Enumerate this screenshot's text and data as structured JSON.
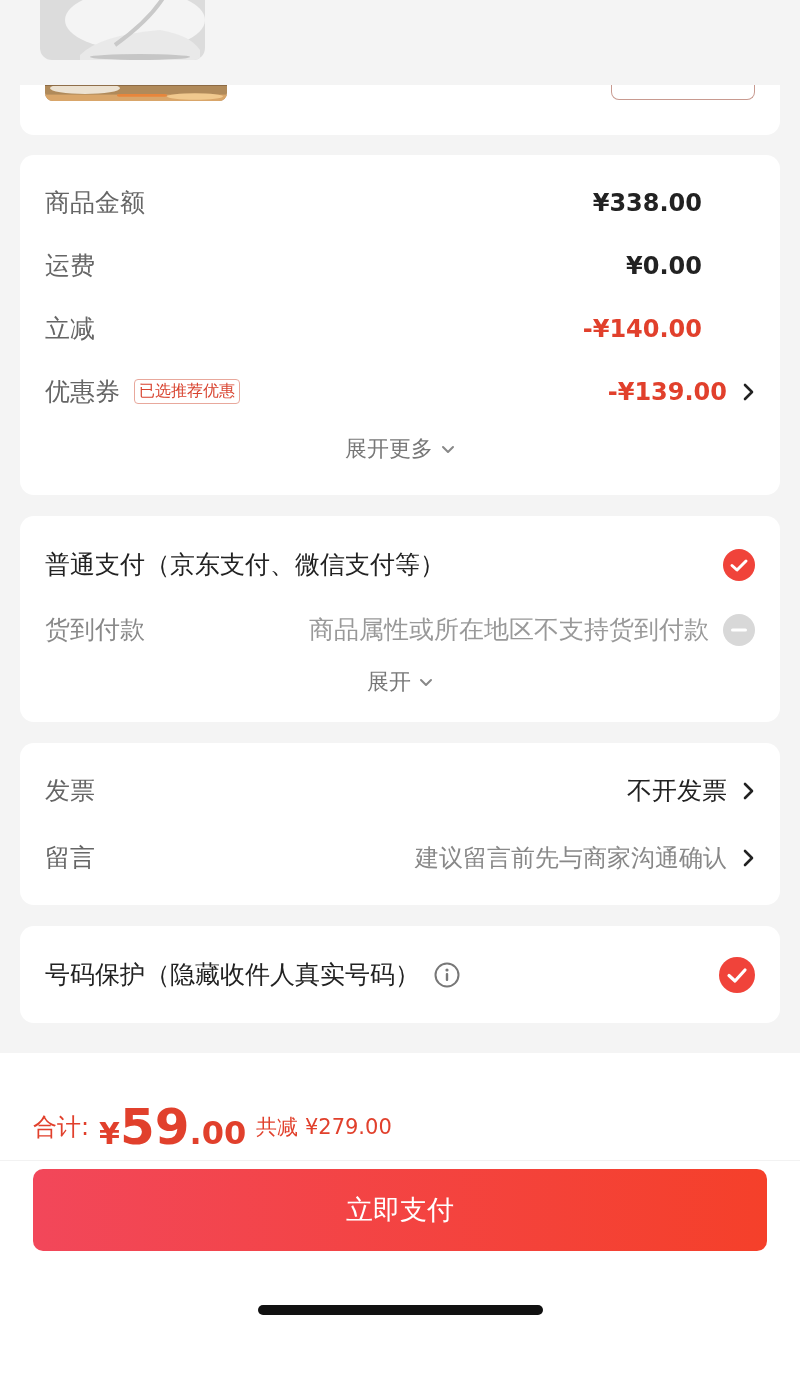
{
  "price_summary": {
    "rows": [
      {
        "label": "商品金额",
        "value": "¥338.00",
        "kind": "plain"
      },
      {
        "label": "运费",
        "value": "¥0.00",
        "kind": "plain"
      },
      {
        "label": "立减",
        "value": "-¥140.00",
        "kind": "discount"
      },
      {
        "label": "优惠券",
        "tag": "已选推荐优惠",
        "value": "-¥139.00",
        "kind": "discount",
        "has_arrow": true
      }
    ],
    "expand": "展开更多"
  },
  "payment": {
    "options": [
      {
        "label": "普通支付（京东支付、微信支付等）",
        "selected": true,
        "disabled": false
      },
      {
        "label": "货到付款",
        "note": "商品属性或所在地区不支持货到付款",
        "selected": false,
        "disabled": true
      }
    ],
    "expand": "展开"
  },
  "extras": [
    {
      "label": "发票",
      "value": "不开发票",
      "kind": "value"
    },
    {
      "label": "留言",
      "value": "建议留言前先与商家沟通确认",
      "kind": "hint"
    }
  ],
  "privacy": {
    "label": "号码保护（隐藏收件人真实号码）",
    "checked": true
  },
  "footer": {
    "total_label": "合计:",
    "currency": "¥",
    "amount_integer": "59",
    "amount_decimal": ".00",
    "savings": "共减 ¥279.00",
    "pay_button": "立即支付"
  }
}
